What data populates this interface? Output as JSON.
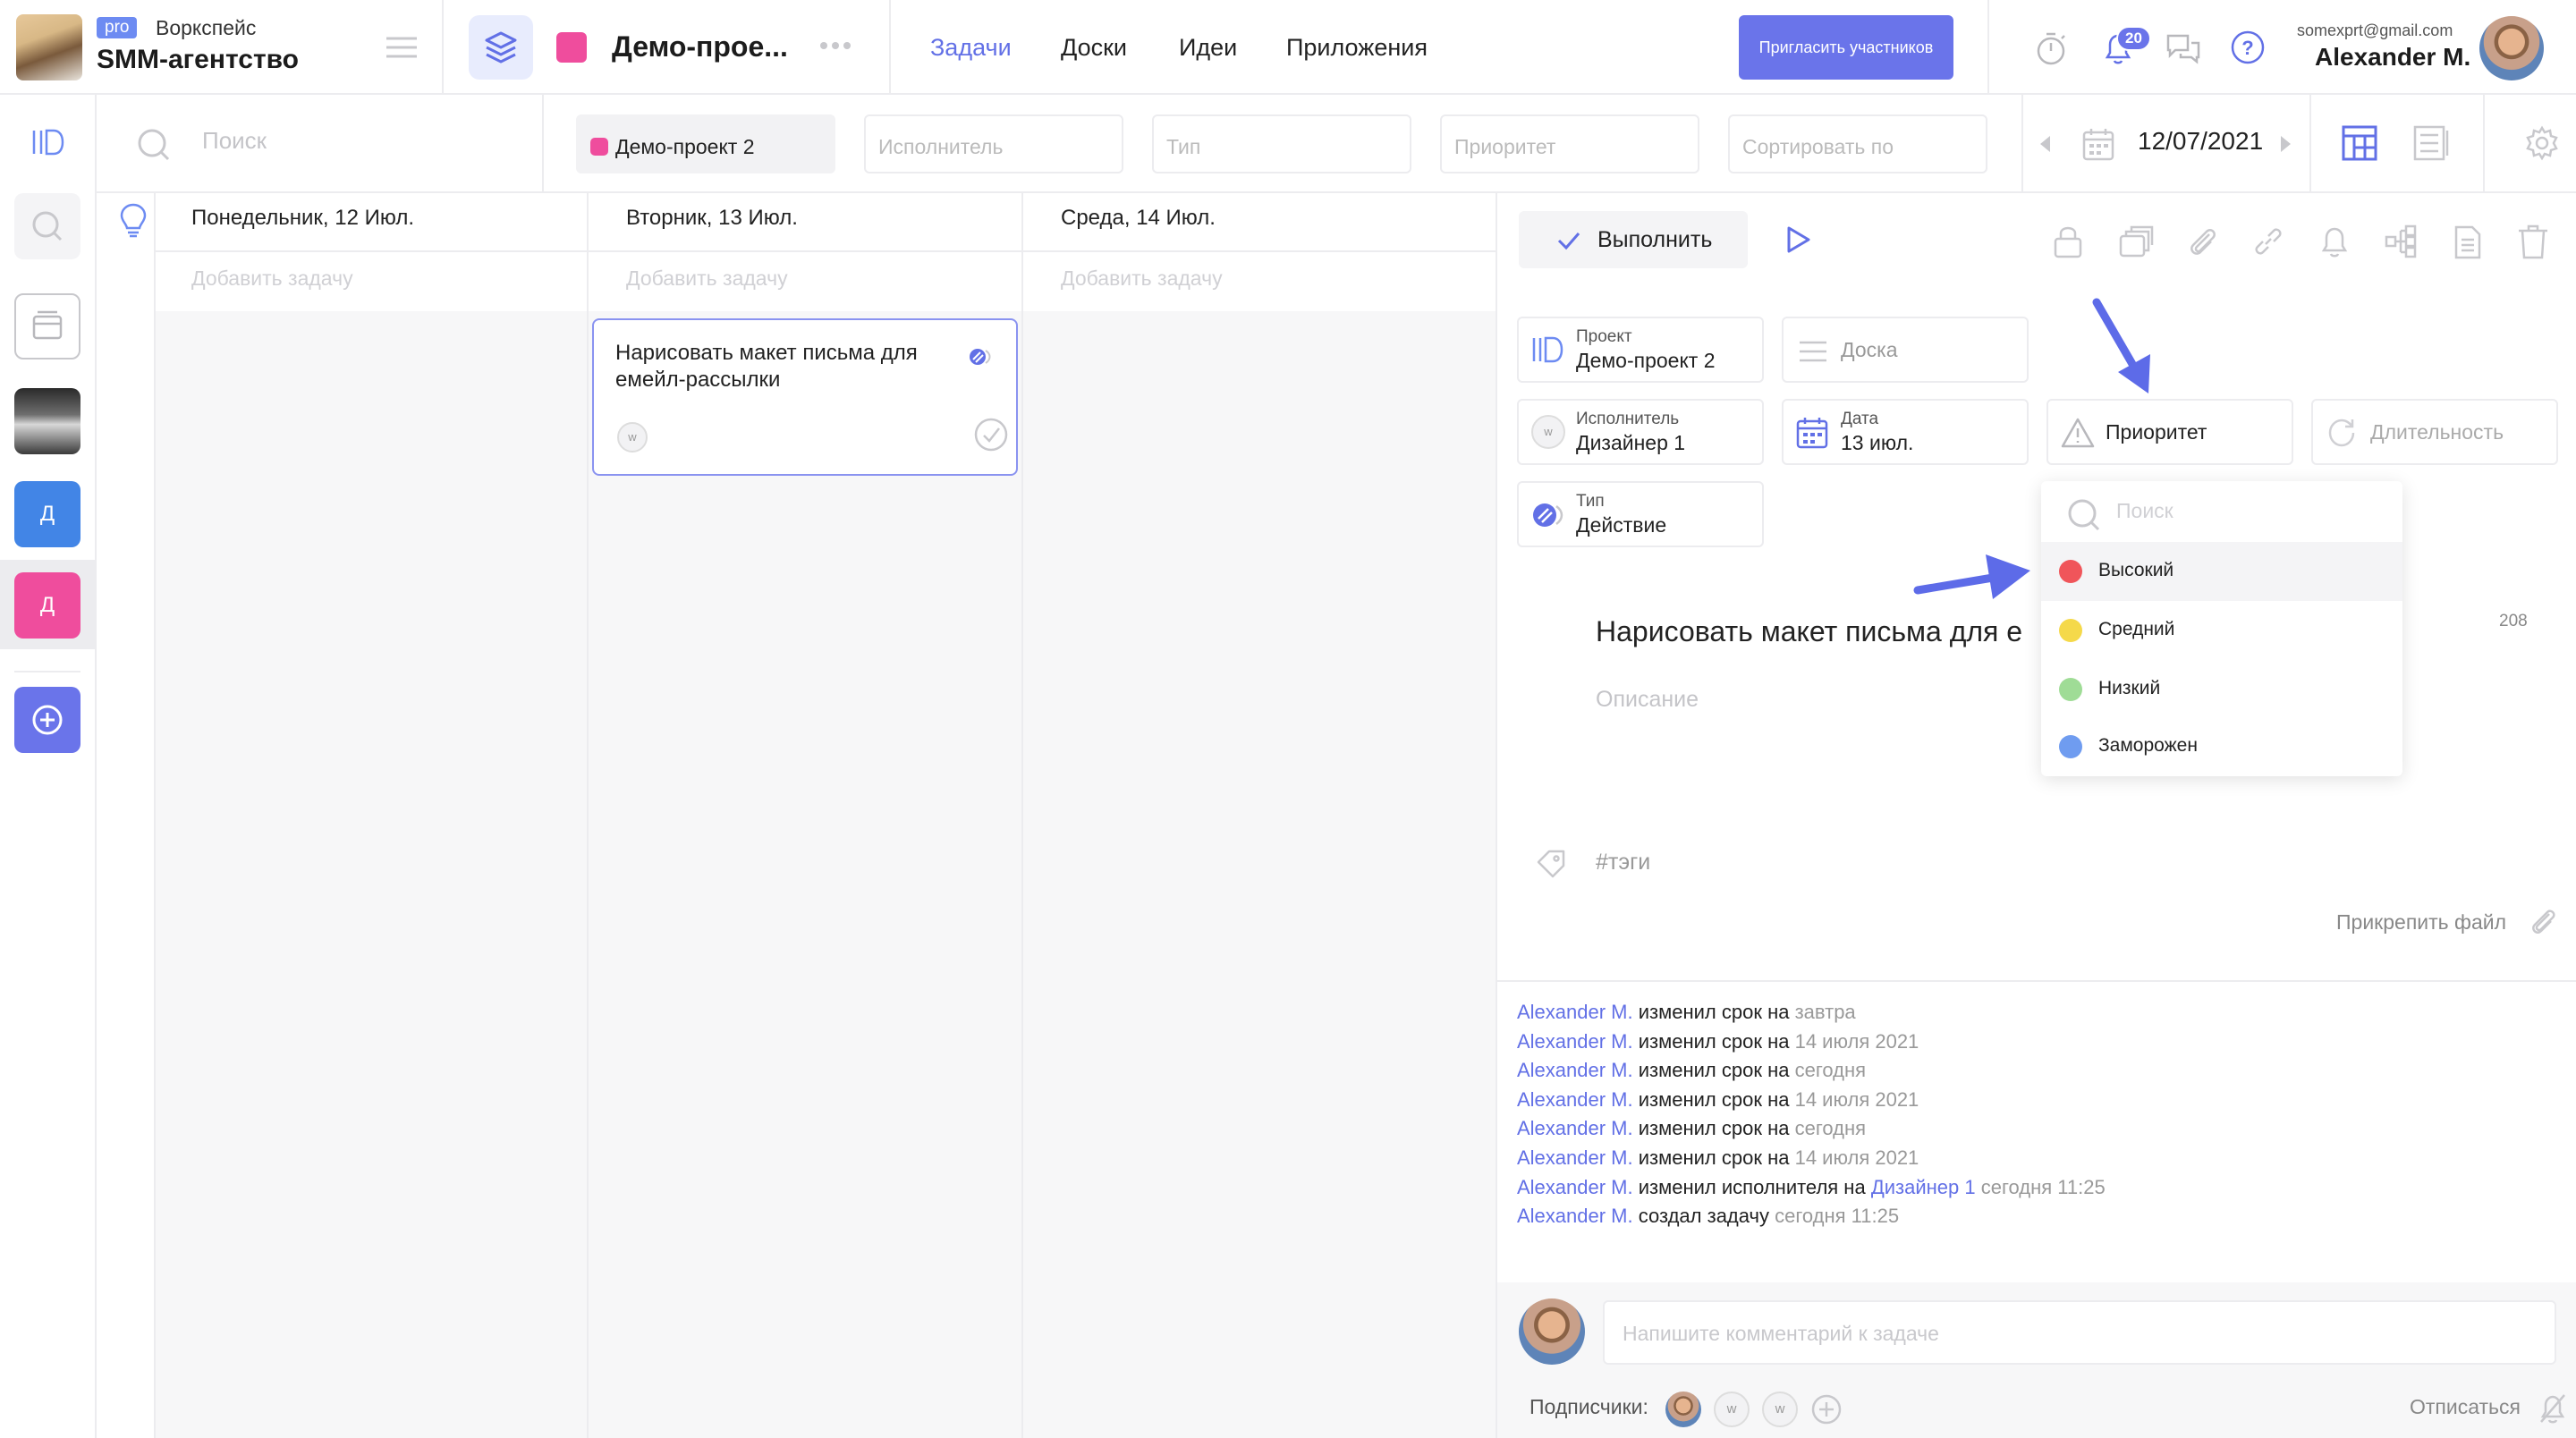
{
  "workspace": {
    "plan": "pro",
    "label": "Воркспейс",
    "name": "SMM-агентство"
  },
  "project": {
    "title": "Демо-прое...",
    "color": "#ef4d9d"
  },
  "nav": [
    "Задачи",
    "Доски",
    "Идеи",
    "Приложения"
  ],
  "nav_active": "Задачи",
  "invite_label": "Пригласить участников",
  "notifications_count": "20",
  "user": {
    "email": "somexprt@gmail.com",
    "name": "Alexander M."
  },
  "sidebar": {
    "letters": [
      "Д",
      "Д"
    ],
    "colors": [
      "#4285e6",
      "#ef4d9d"
    ]
  },
  "filters": {
    "search_placeholder": "Поиск",
    "project": "Демо-проект 2",
    "assignee_placeholder": "Исполнитель",
    "type_placeholder": "Тип",
    "priority_placeholder": "Приоритет",
    "sort_placeholder": "Сортировать по",
    "date": "12/07/2021"
  },
  "calendar": {
    "days": [
      "Понедельник, 12 Июл.",
      "Вторник, 13 Июл.",
      "Среда, 14 Июл."
    ],
    "add_task": "Добавить задачу",
    "card": {
      "title": "Нарисовать макет письма для емейл-рассылки",
      "assignee_initial": "w"
    }
  },
  "panel": {
    "done_label": "Выполнить",
    "chips": {
      "project": {
        "label": "Проект",
        "value": "Демо-проект 2"
      },
      "board": {
        "value": "Доска"
      },
      "assignee": {
        "label": "Исполнитель",
        "value": "Дизайнер 1"
      },
      "date": {
        "label": "Дата",
        "value": "13 июл."
      },
      "priority": {
        "value": "Приоритет"
      },
      "duration": {
        "value": "Длительность"
      },
      "type": {
        "label": "Тип",
        "value": "Действие"
      }
    },
    "task_title": "Нарисовать макет письма для е",
    "char_counter": "208",
    "description_placeholder": "Описание",
    "tags_placeholder": "#тэги",
    "attach_label": "Прикрепить файл",
    "activity": [
      {
        "user": "Alexander M.",
        "action": "изменил срок на",
        "value": "завтра"
      },
      {
        "user": "Alexander M.",
        "action": "изменил срок на",
        "value": "14 июля 2021"
      },
      {
        "user": "Alexander M.",
        "action": "изменил срок на",
        "value": "сегодня"
      },
      {
        "user": "Alexander M.",
        "action": "изменил срок на",
        "value": "14 июля 2021"
      },
      {
        "user": "Alexander M.",
        "action": "изменил срок на",
        "value": "сегодня"
      },
      {
        "user": "Alexander M.",
        "action": "изменил срок на",
        "value": "14 июля 2021"
      },
      {
        "user": "Alexander M.",
        "action": "изменил исполнителя на",
        "link": "Дизайнер 1",
        "value": "сегодня 11:25"
      },
      {
        "user": "Alexander M.",
        "action": "создал задачу",
        "value": "сегодня 11:25"
      }
    ],
    "comment_placeholder": "Напишите комментарий к задаче",
    "subscribers_label": "Подписчики:",
    "subscriber_initials": [
      "w",
      "w"
    ],
    "unsubscribe_label": "Отписаться"
  },
  "priority_dropdown": {
    "search_placeholder": "Поиск",
    "options": [
      {
        "label": "Высокий",
        "color": "#f0555a"
      },
      {
        "label": "Средний",
        "color": "#f5d94a"
      },
      {
        "label": "Низкий",
        "color": "#9fdc96"
      },
      {
        "label": "Заморожен",
        "color": "#6f9cf0"
      }
    ]
  }
}
